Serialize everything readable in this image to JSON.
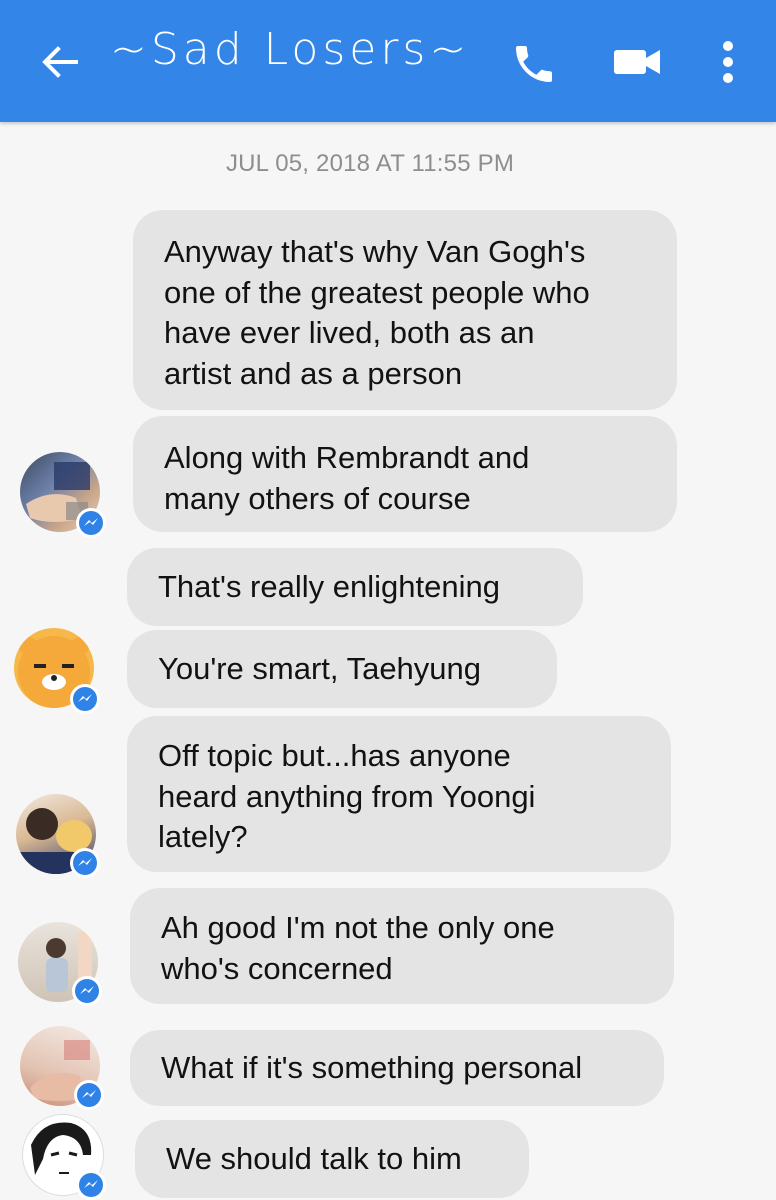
{
  "header": {
    "title": "~Sad Losers~",
    "back_icon": "arrow-left-icon",
    "call_icon": "phone-icon",
    "video_icon": "video-camera-icon",
    "menu_icon": "more-vertical-icon",
    "color": "#3385e8"
  },
  "thread": {
    "timestamp": "JUL 05, 2018 AT 11:55 PM",
    "bubble_color": "#e4e4e4",
    "messages": [
      {
        "text": "Anyway that's why Van Gogh's\none of the greatest people who\nhave ever lived, both as an\nartist and as a person"
      },
      {
        "text": "Along with Rembrandt and\nmany others of course"
      },
      {
        "text": "That's really enlightening"
      },
      {
        "text": "You're smart, Taehyung"
      },
      {
        "text": "Off topic but...has anyone\nheard anything from Yoongi\nlately?"
      },
      {
        "text": "Ah good I'm not the only one\nwho's concerned"
      },
      {
        "text": "What if it's something personal"
      },
      {
        "text": "We should talk to him"
      }
    ]
  }
}
